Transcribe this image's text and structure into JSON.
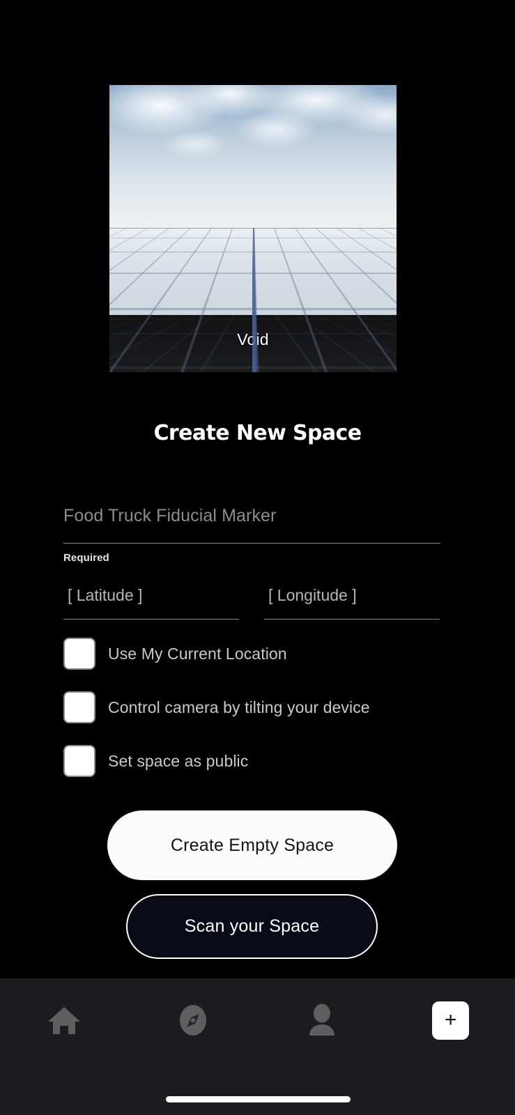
{
  "preview": {
    "label": "Void",
    "scene": "perspective-grid-skybox"
  },
  "header": {
    "title": "Create New Space"
  },
  "form": {
    "name_field": {
      "placeholder": "Food Truck Fiducial Marker",
      "value": "",
      "helper": "Required"
    },
    "latitude": {
      "placeholder": "[ Latitude ]",
      "value": ""
    },
    "longitude": {
      "placeholder": "[ Longitude ]",
      "value": ""
    },
    "checkboxes": [
      {
        "label": "Use My Current Location",
        "checked": false
      },
      {
        "label": "Control camera by tilting your device",
        "checked": false
      },
      {
        "label": "Set space as public",
        "checked": false
      }
    ]
  },
  "actions": {
    "primary": "Create Empty Space",
    "secondary": "Scan your Space"
  },
  "navbar": {
    "items": [
      {
        "icon": "home-icon",
        "label": ""
      },
      {
        "icon": "compass-icon",
        "label": ""
      },
      {
        "icon": "person-icon",
        "label": ""
      },
      {
        "icon": "plus-icon",
        "label": "+"
      }
    ]
  },
  "colors": {
    "background": "#000000",
    "navbar": "#1b1b20",
    "primary_button": "#fbfbfb",
    "secondary_button": "#0b0b18",
    "accent_text": "#ffffff",
    "muted_text": "#8d8d8d",
    "label_text": "#c9c9c9",
    "nav_icon": "#5e5e5e",
    "underline": "#8b8b8b"
  }
}
